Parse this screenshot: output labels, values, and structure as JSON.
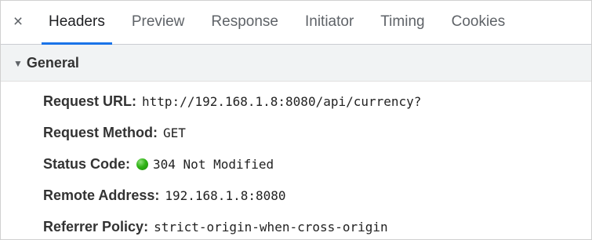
{
  "tabbar": {
    "close_symbol": "×",
    "tabs": [
      {
        "label": "Headers",
        "active": true
      },
      {
        "label": "Preview",
        "active": false
      },
      {
        "label": "Response",
        "active": false
      },
      {
        "label": "Initiator",
        "active": false
      },
      {
        "label": "Timing",
        "active": false
      },
      {
        "label": "Cookies",
        "active": false
      }
    ]
  },
  "general": {
    "toggle_symbol": "▼",
    "title": "General",
    "rows": [
      {
        "key": "Request URL:",
        "value": "http://192.168.1.8:8080/api/currency?"
      },
      {
        "key": "Request Method:",
        "value": "GET"
      },
      {
        "key": "Status Code:",
        "value": "304 Not Modified",
        "status_color": "#2fb315"
      },
      {
        "key": "Remote Address:",
        "value": "192.168.1.8:8080"
      },
      {
        "key": "Referrer Policy:",
        "value": "strict-origin-when-cross-origin"
      }
    ]
  },
  "colors": {
    "active_tab_underline": "#1a73e8",
    "section_header_bg": "#f1f3f4"
  }
}
